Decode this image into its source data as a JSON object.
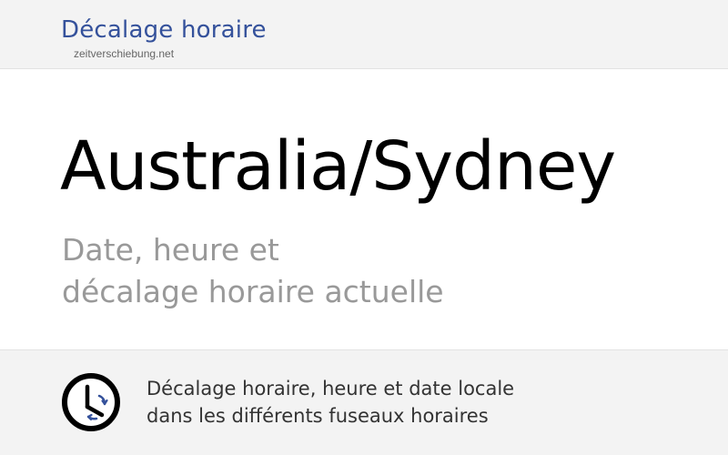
{
  "header": {
    "title": "Décalage horaire",
    "site": "zeitverschiebung.net"
  },
  "main": {
    "title": "Australia/Sydney",
    "subtitle_line1": "Date, heure et",
    "subtitle_line2": "décalage horaire actuelle"
  },
  "footer": {
    "icon": "clock-icon",
    "line1": "Décalage horaire, heure et date locale",
    "line2": "dans les différents fuseaux horaires"
  },
  "colors": {
    "brand": "#34519b",
    "title": "#000000",
    "subtitle": "#999999",
    "panel_bg": "#f3f3f3",
    "icon_accent": "#34519b"
  }
}
